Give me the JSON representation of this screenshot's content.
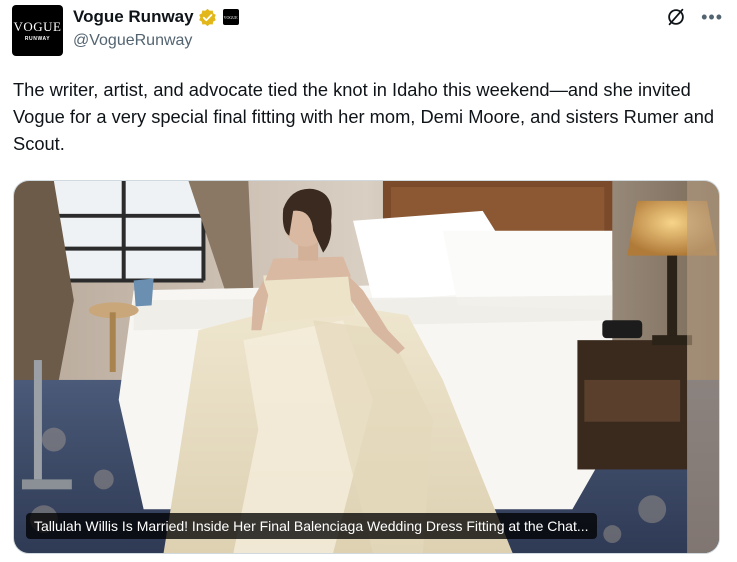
{
  "author": {
    "display_name": "Vogue Runway",
    "handle": "@VogueRunway",
    "avatar_text_main": "VOGUE",
    "avatar_text_sub": "RUNWAY",
    "affiliate_badge_text": "VOGUE"
  },
  "icons": {
    "verified": "verified-badge-icon",
    "grok": "grok-icon",
    "more": "more-icon"
  },
  "colors": {
    "verified_gold": "#e2b719",
    "text": "#0f1419",
    "secondary_text": "#536471"
  },
  "tweet": {
    "text": "The writer, artist, and advocate tied the knot in Idaho this weekend—and she invited Vogue for a very special final fitting with her mom, Demi Moore, and sisters Rumer and Scout."
  },
  "card": {
    "caption": "Tallulah Willis Is Married! Inside Her Final Balenciaga Wedding Dress Fitting at the Chat..."
  }
}
